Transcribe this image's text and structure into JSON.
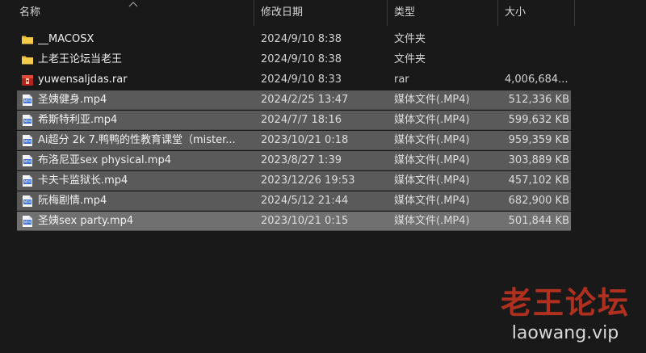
{
  "header": {
    "col_name": "名称",
    "col_date": "修改日期",
    "col_type": "类型",
    "col_size": "大小"
  },
  "files": [
    {
      "name": "__MACOSX",
      "date": "2024/9/10 8:38",
      "type": "文件夹",
      "size": "",
      "icon": "folder-icon",
      "selected": false
    },
    {
      "name": "上老王论坛当老王",
      "date": "2024/9/10 8:38",
      "type": "文件夹",
      "size": "",
      "icon": "folder-icon",
      "selected": false
    },
    {
      "name": "yuwensaljdas.rar",
      "date": "2024/9/10 8:33",
      "type": "rar",
      "size": "4,006,684...",
      "icon": "rar-archive-icon",
      "selected": false
    },
    {
      "name": "圣姨健身.mp4",
      "date": "2024/2/25 13:47",
      "type": "媒体文件(.MP4)",
      "size": "512,336 KB",
      "icon": "mp4-file-icon",
      "selected": true
    },
    {
      "name": "希斯特利亚.mp4",
      "date": "2024/7/7 18:16",
      "type": "媒体文件(.MP4)",
      "size": "599,632 KB",
      "icon": "mp4-file-icon",
      "selected": true
    },
    {
      "name": "Ai超分 2k 7.鸭鸭的性教育课堂（mister...",
      "date": "2023/10/21 0:18",
      "type": "媒体文件(.MP4)",
      "size": "959,359 KB",
      "icon": "mp4-file-icon",
      "selected": true
    },
    {
      "name": "布洛尼亚sex physical.mp4",
      "date": "2023/8/27 1:39",
      "type": "媒体文件(.MP4)",
      "size": "303,889 KB",
      "icon": "mp4-file-icon",
      "selected": true
    },
    {
      "name": "卡夫卡监狱长.mp4",
      "date": "2023/12/26 19:53",
      "type": "媒体文件(.MP4)",
      "size": "457,102 KB",
      "icon": "mp4-file-icon",
      "selected": true
    },
    {
      "name": "阮梅剧情.mp4",
      "date": "2024/5/12 21:44",
      "type": "媒体文件(.MP4)",
      "size": "682,900 KB",
      "icon": "mp4-file-icon",
      "selected": true
    },
    {
      "name": "圣姨sex party.mp4",
      "date": "2023/10/21 0:15",
      "type": "媒体文件(.MP4)",
      "size": "501,844 KB",
      "icon": "mp4-file-icon",
      "selected": true
    }
  ],
  "watermark": {
    "title": "老王论坛",
    "url": "laowang.vip"
  },
  "colors": {
    "background": "#191919",
    "selection": "#5a5a5a",
    "watermark_red": "#b03020"
  }
}
